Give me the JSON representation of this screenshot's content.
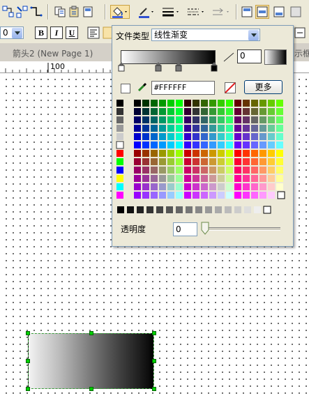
{
  "tabs": {
    "active_label": "箭头2 (New Page 1)",
    "partial_label": "示框"
  },
  "ruler": {
    "mark_100": "100"
  },
  "format_bar": {
    "font_size": "0",
    "bold": "B",
    "italic": "I",
    "underline": "U"
  },
  "fill_panel": {
    "fill_type_label": "文件类型",
    "fill_type_value": "线性渐变",
    "angle_value": "0",
    "hex_value": "#FFFFFF",
    "more_button": "更多",
    "opacity_label": "透明度",
    "opacity_value": "0",
    "grays": [
      "#000000",
      "#333333",
      "#666666",
      "#999999",
      "#cccccc",
      "#ffffff"
    ],
    "basics": [
      "#ff0000",
      "#00ff00",
      "#0000ff",
      "#ffff00",
      "#00ffff",
      "#ff00ff"
    ],
    "grayscale_row": [
      "#000000",
      "#111111",
      "#222222",
      "#333333",
      "#444444",
      "#555555",
      "#666666",
      "#777777",
      "#888888",
      "#999999",
      "#aaaaaa",
      "#bbbbbb",
      "#cccccc",
      "#dddddd",
      "#eeeeee",
      "#ffffff"
    ]
  },
  "icons": {
    "toolbar": [
      "connect-icon",
      "connector-icon",
      "copy-format-icon",
      "format-paste-icon",
      "page-icon",
      "fill-color-icon",
      "line-color-icon",
      "line-weight-icon",
      "line-dash-icon",
      "arrow-style-icon",
      "align-top-icon",
      "align-middle-icon",
      "align-bottom-icon"
    ]
  }
}
